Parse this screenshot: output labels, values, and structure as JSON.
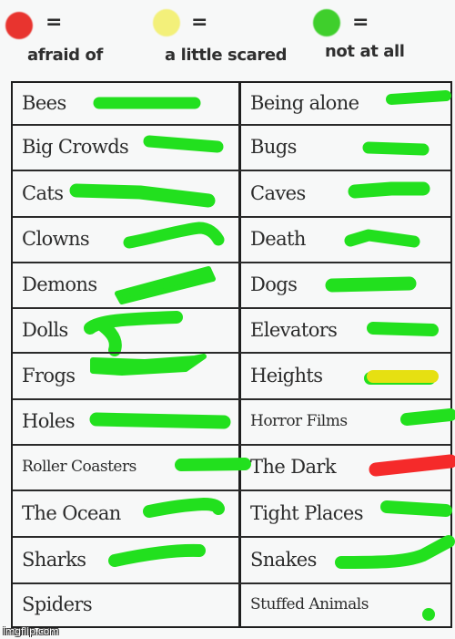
{
  "legend": [
    {
      "symbol": "=",
      "label": "afraid of",
      "color": "#e8342f",
      "level": "afraid"
    },
    {
      "symbol": "=",
      "label": "a little scared",
      "color": "#f3f07a",
      "level": "little"
    },
    {
      "symbol": "=",
      "label": "not at all",
      "color": "#3fcf2c",
      "level": "none"
    }
  ],
  "mark_colors": {
    "none": "#22e01e",
    "little": "#e6e012",
    "afraid": "#f52a2a"
  },
  "rows": [
    {
      "left": {
        "label": "Bees",
        "rating": "none"
      },
      "right": {
        "label": "Being alone",
        "rating": "none"
      }
    },
    {
      "left": {
        "label": "Big Crowds",
        "rating": "none"
      },
      "right": {
        "label": "Bugs",
        "rating": "none"
      }
    },
    {
      "left": {
        "label": "Cats",
        "rating": "none"
      },
      "right": {
        "label": "Caves",
        "rating": "none"
      }
    },
    {
      "left": {
        "label": "Clowns",
        "rating": "none"
      },
      "right": {
        "label": "Death",
        "rating": "none"
      }
    },
    {
      "left": {
        "label": "Demons",
        "rating": "none"
      },
      "right": {
        "label": "Dogs",
        "rating": "none"
      }
    },
    {
      "left": {
        "label": "Dolls",
        "rating": "none"
      },
      "right": {
        "label": "Elevators",
        "rating": "none"
      }
    },
    {
      "left": {
        "label": "Frogs",
        "rating": "none"
      },
      "right": {
        "label": "Heights",
        "rating": "little"
      }
    },
    {
      "left": {
        "label": "Holes",
        "rating": "none"
      },
      "right": {
        "label": "Horror Films",
        "rating": "none"
      }
    },
    {
      "left": {
        "label": "Roller Coasters",
        "rating": "none"
      },
      "right": {
        "label": "The Dark",
        "rating": "afraid"
      }
    },
    {
      "left": {
        "label": "The Ocean",
        "rating": "none"
      },
      "right": {
        "label": "Tight Places",
        "rating": "none"
      }
    },
    {
      "left": {
        "label": "Sharks",
        "rating": "none"
      },
      "right": {
        "label": "Snakes",
        "rating": "none"
      }
    },
    {
      "left": {
        "label": "Spiders",
        "rating": null
      },
      "right": {
        "label": "Stuffed Animals",
        "rating": "none"
      }
    }
  ],
  "watermark": "imgflip.com"
}
